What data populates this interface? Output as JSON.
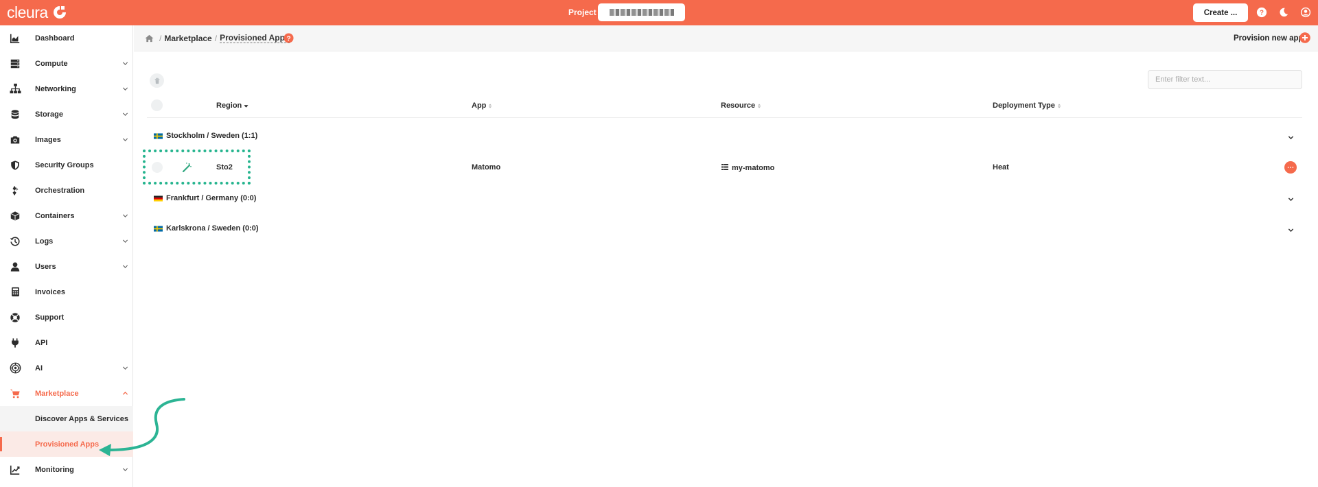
{
  "header": {
    "brand": "cleura",
    "project_label": "Project",
    "create_label": "Create ...",
    "icons": [
      "help-circle-icon",
      "moon-icon",
      "user-circle-icon"
    ],
    "accent_color": "#f56a4c"
  },
  "sidebar": {
    "items": [
      {
        "label": "Dashboard",
        "icon": "chart-area-icon"
      },
      {
        "label": "Compute",
        "icon": "server-icon"
      },
      {
        "label": "Networking",
        "icon": "network-icon"
      },
      {
        "label": "Storage",
        "icon": "database-icon"
      },
      {
        "label": "Images",
        "icon": "camera-icon"
      },
      {
        "label": "Security Groups",
        "icon": "shield-icon"
      },
      {
        "label": "Orchestration",
        "icon": "orchestration-icon"
      },
      {
        "label": "Containers",
        "icon": "cube-icon"
      },
      {
        "label": "Logs",
        "icon": "history-icon"
      },
      {
        "label": "Users",
        "icon": "user-icon"
      },
      {
        "label": "Invoices",
        "icon": "calculator-icon"
      },
      {
        "label": "Support",
        "icon": "lifebuoy-icon"
      },
      {
        "label": "API",
        "icon": "plug-icon"
      },
      {
        "label": "AI",
        "icon": "ai-icon"
      },
      {
        "label": "Marketplace",
        "icon": "cart-icon"
      },
      {
        "label": "Monitoring",
        "icon": "chart-line-icon"
      }
    ],
    "marketplace_sub": [
      {
        "label": "Discover Apps & Services"
      },
      {
        "label": "Provisioned Apps"
      }
    ]
  },
  "breadcrumb": {
    "items": [
      "Marketplace",
      "Provisioned Apps"
    ],
    "separator": "/"
  },
  "toolbar": {
    "provision_label": "Provision new app",
    "filter_placeholder": "Enter filter text..."
  },
  "table": {
    "columns": [
      "Region",
      "App",
      "Resource",
      "Deployment Type"
    ],
    "groups": [
      {
        "label": "Stockholm / Sweden",
        "count": "(1:1)",
        "flag": "se"
      },
      {
        "label": "Frankfurt / Germany",
        "count": "(0:0)",
        "flag": "de"
      },
      {
        "label": "Karlskrona / Sweden",
        "count": "(0:0)",
        "flag": "se"
      }
    ],
    "rows": [
      {
        "region": "Sto2",
        "app": "Matomo",
        "resource": "my-matomo",
        "deployment_type": "Heat"
      }
    ]
  }
}
